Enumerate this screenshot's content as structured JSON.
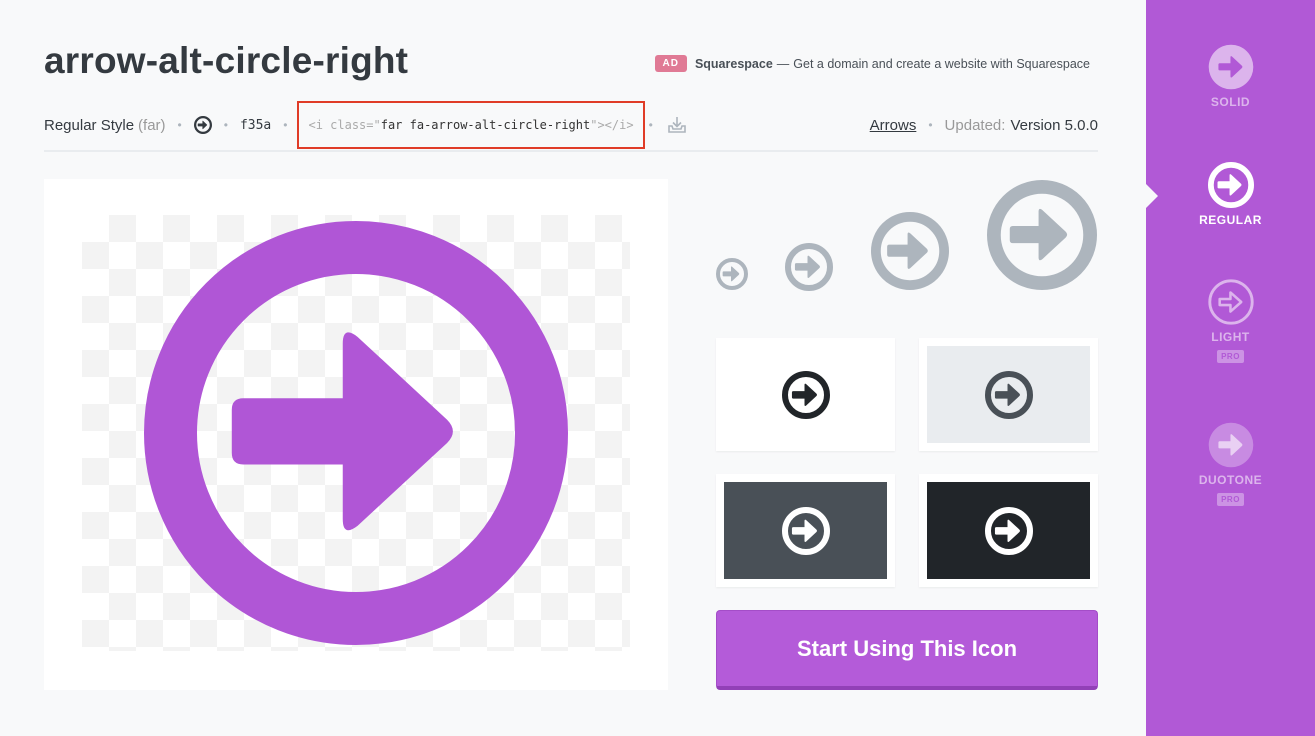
{
  "header": {
    "title": "arrow-alt-circle-right",
    "ad": {
      "badge": "AD",
      "brand": "Squarespace",
      "separator": "—",
      "text": "Get a domain and create a website with Squarespace"
    }
  },
  "meta": {
    "style_label": "Regular Style",
    "style_prefix": "(far)",
    "unicode": "f35a",
    "code": {
      "open": "<i class=\"",
      "classes": "far fa-arrow-alt-circle-right",
      "close": "\"></i>"
    },
    "category": "Arrows",
    "updated_label": "Updated:",
    "version": "Version 5.0.0"
  },
  "cta_label": "Start Using This Icon",
  "styles": [
    {
      "label": "SOLID",
      "icon": "arrow-circle-solid-icon"
    },
    {
      "label": "REGULAR",
      "icon": "arrow-circle-regular-icon"
    },
    {
      "label": "LIGHT",
      "icon": "arrow-circle-light-icon",
      "pro": "PRO"
    },
    {
      "label": "DUOTONE",
      "icon": "arrow-circle-duotone-icon",
      "pro": "PRO"
    }
  ],
  "colors": {
    "accent": "#b159d6",
    "icon_purple": "#b056d6",
    "icon_gray": "#adb5bd",
    "highlight": "#e03c27"
  }
}
